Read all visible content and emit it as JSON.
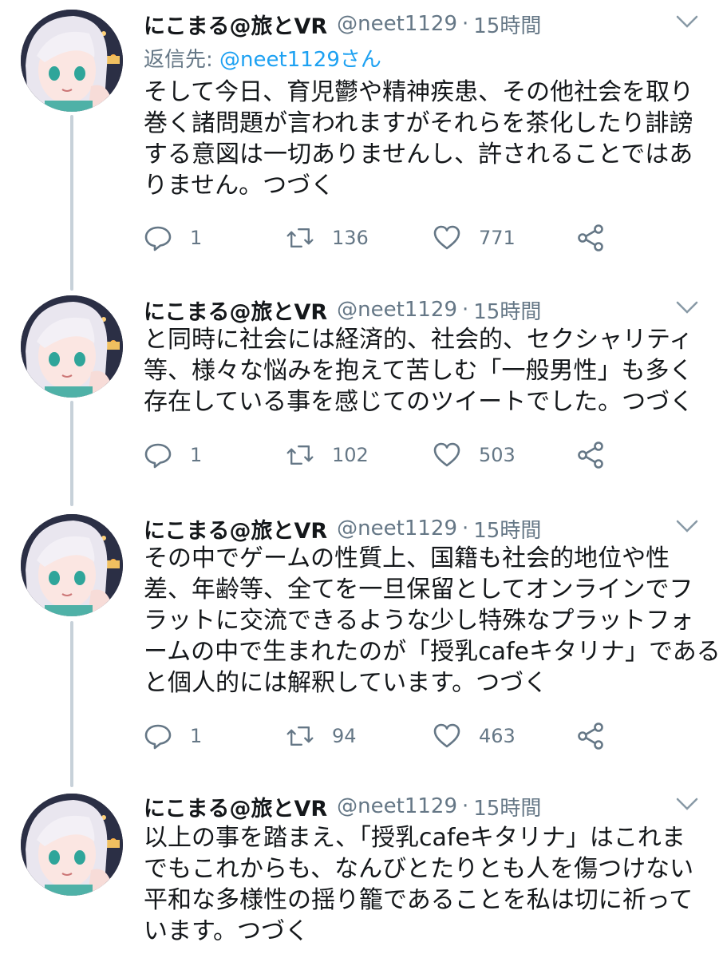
{
  "tweets": [
    {
      "name": "にこまる@旅とVR",
      "handle": "@neet1129",
      "time": "15時間",
      "reply_prefix": "返信先:",
      "reply_target": "@neet1129さん",
      "text": "そして今日、育児鬱や精神疾患、その他社会を取り\n巻く諸問題が言われますがそれらを茶化したり誹謗\nする意図は一切ありませんし、許されることではあ\nりません。つづく",
      "replies": "1",
      "retweets": "136",
      "likes": "771"
    },
    {
      "name": "にこまる@旅とVR",
      "handle": "@neet1129",
      "time": "15時間",
      "text": "と同時に社会には経済的、社会的、セクシャリティ\n等、様々な悩みを抱えて苦しむ「一般男性」も多く\n存在している事を感じてのツイートでした。つづく",
      "replies": "1",
      "retweets": "102",
      "likes": "503"
    },
    {
      "name": "にこまる@旅とVR",
      "handle": "@neet1129",
      "time": "15時間",
      "text": "その中でゲームの性質上、国籍も社会的地位や性\n差、年齢等、全てを一旦保留としてオンラインでフ\nラットに交流できるような少し特殊なプラットフォ\nームの中で生まれたのが「授乳cafeキタリナ」である\nと個人的には解釈しています。つづく",
      "replies": "1",
      "retweets": "94",
      "likes": "463"
    },
    {
      "name": "にこまる@旅とVR",
      "handle": "@neet1129",
      "time": "15時間",
      "text": "以上の事を踏まえ、「授乳cafeキタリナ」はこれま\nでもこれからも、なんびとたりとも人を傷つけない\n平和な多様性の揺り籠であることを私は切に祈って\nいます。つづく"
    }
  ],
  "separator": "·",
  "colors": {
    "text": "#14171a",
    "secondary": "#657786",
    "link": "#1da1f2",
    "thread_line": "#c7d1d9"
  },
  "icons": [
    "reply-icon",
    "retweet-icon",
    "like-icon",
    "share-icon",
    "chevron-down-icon"
  ]
}
